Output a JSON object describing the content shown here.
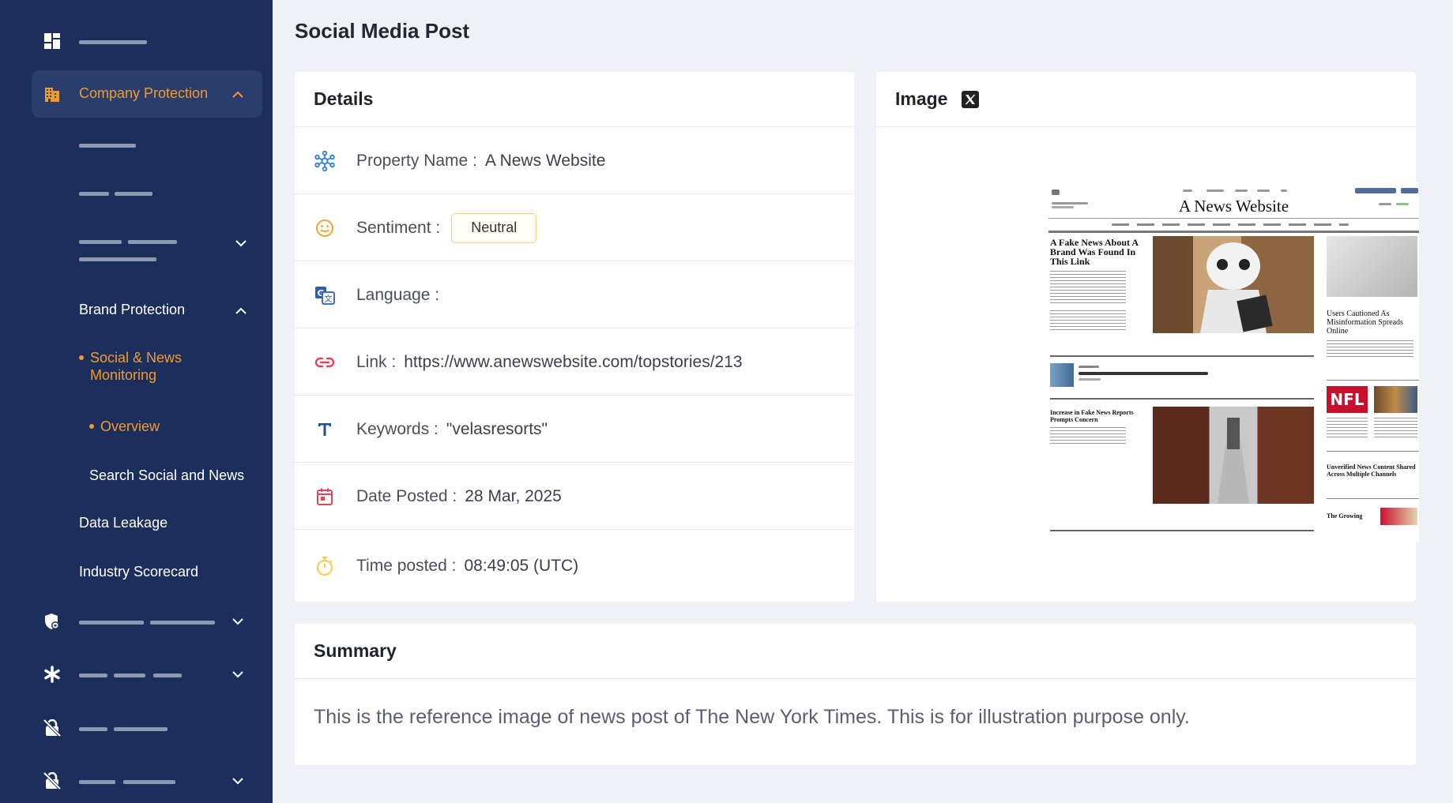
{
  "sidebar": {
    "company_protection": "Company Protection",
    "brand_protection": "Brand Protection",
    "social_news_monitoring": "Social & News Monitoring",
    "overview": "Overview",
    "search_social_news": "Search Social and News",
    "data_leakage": "Data Leakage",
    "industry_scorecard": "Industry Scorecard"
  },
  "page": {
    "title": "Social Media Post"
  },
  "details": {
    "header": "Details",
    "property_name_label": "Property Name :",
    "property_name_value": "A News Website",
    "sentiment_label": "Sentiment :",
    "sentiment_value": "Neutral",
    "language_label": "Language :",
    "link_label": "Link :",
    "link_value": "https://www.anewswebsite.com/topstories/213",
    "keywords_label": "Keywords :",
    "keywords_value": "\"velasresorts\"",
    "date_label": "Date Posted :",
    "date_value": "28 Mar, 2025",
    "time_label": "Time posted :",
    "time_value": "08:49:05 (UTC)"
  },
  "image_card": {
    "header": "Image",
    "news_site_title": "A News Website",
    "headline_1": "A Fake News About A Brand Was Found In This Link",
    "headline_2": "Users Cautioned As Misinformation Spreads Online",
    "headline_3": "Increase in Fake News Reports Prompts Concern",
    "headline_4": "Unverified News Content Shared Across Multiple Channels",
    "headline_5": "The Growing",
    "nfl_text": "NFL"
  },
  "summary": {
    "header": "Summary",
    "text": "This is the reference image of news post of The New York Times. This is for illustration purpose only."
  },
  "colors": {
    "sidebar_bg": "#1c2f5c",
    "accent_orange": "#f29a2e",
    "page_bg": "#eef1f6"
  }
}
